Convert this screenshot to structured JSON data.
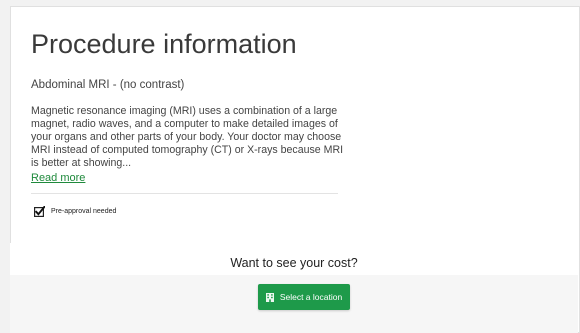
{
  "page": {
    "title": "Procedure information"
  },
  "procedure": {
    "name": "Abdominal MRI - (no contrast)",
    "description": "Magnetic resonance imaging (MRI) uses a combination of a large magnet, radio waves, and a computer to make detailed images of your organs and other parts of your body. Your doctor may choose MRI instead of computed tomography (CT) or X-rays because MRI is better at showing...",
    "read_more_label": "Read more",
    "preapproval_label": "Pre-approval needed",
    "preapproval_checked": true
  },
  "cost": {
    "prompt": "Want to see your cost?",
    "select_location_label": "Select a location"
  },
  "icons": {
    "checkbox": "checkbox-checked-icon",
    "location": "building-icon"
  },
  "colors": {
    "accent_green": "#1e9a4a",
    "link_green": "#1f8a3c"
  }
}
